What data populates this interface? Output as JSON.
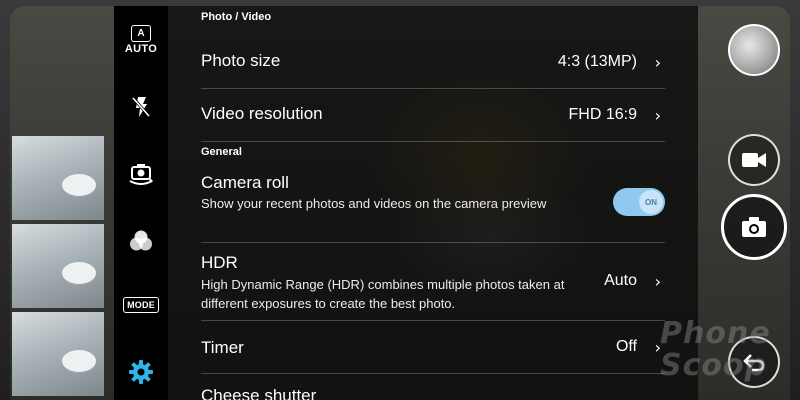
{
  "sections": [
    {
      "header": "Photo / Video"
    },
    {
      "header": "General"
    }
  ],
  "rows": {
    "photo_size": {
      "title": "Photo size",
      "value": "4:3 (13MP)"
    },
    "video_resolution": {
      "title": "Video resolution",
      "value": "FHD 16:9"
    },
    "camera_roll": {
      "title": "Camera roll",
      "description": "Show your recent photos and videos on the camera preview",
      "toggle_label": "ON",
      "toggle_on": true
    },
    "hdr": {
      "title": "HDR",
      "description": "High Dynamic Range (HDR) combines multiple photos taken at different exposures to create the best photo.",
      "value": "Auto"
    },
    "timer": {
      "title": "Timer",
      "value": "Off"
    },
    "cheese_shutter": {
      "title": "Cheese shutter"
    }
  },
  "iconbar": {
    "auto_badge_letter": "A",
    "auto_badge_label": "AUTO",
    "mode_label": "MODE"
  },
  "icons": {
    "flash": "flash-off-icon",
    "switch_camera": "switch-camera-icon",
    "filters": "color-filter-icon",
    "settings": "gear-icon",
    "video": "video-camera-icon",
    "shutter": "camera-icon",
    "back": "back-arrow-icon"
  },
  "watermark": {
    "line1": "Phone",
    "line2": "Scoop"
  },
  "colors": {
    "accent": "#2fb3e8",
    "toggle_on": "#8fc9ef",
    "panel": "#0c0c0c"
  }
}
